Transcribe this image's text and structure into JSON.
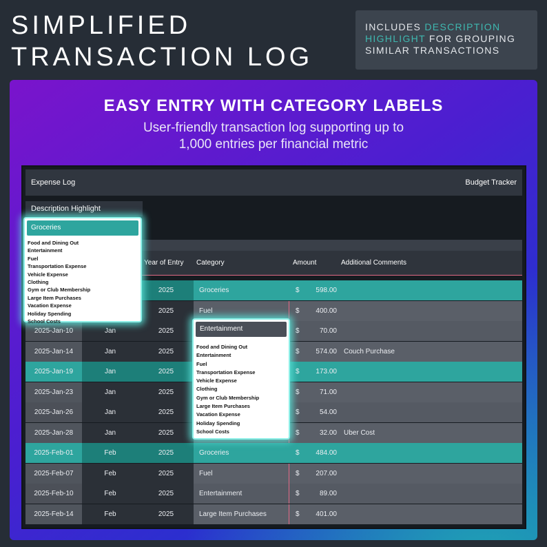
{
  "title": {
    "line1": "SIMPLIFIED",
    "line2": "TRANSACTION LOG"
  },
  "callout": {
    "prefix": "INCLUDES ",
    "highlight_1": "DESCRIPTION",
    "highlight_2": "HIGHLIGHT",
    "suffix": " FOR GROUPING SIMILAR TRANSACTIONS",
    "highlight_color": "#3fb8b0"
  },
  "panel": {
    "heading": "EASY ENTRY WITH CATEGORY LABELS",
    "subtitle_line1": "User-friendly transaction log supporting up to",
    "subtitle_line2": "1,000 entries per financial metric"
  },
  "sheet": {
    "left_title": "Expense Log",
    "right_title": "Budget Tracker",
    "description_label": "Description Highlight",
    "columns": {
      "year": "Year of Entry",
      "category": "Category",
      "amount": "Amount",
      "comments": "Additional Comments"
    },
    "currency": "$",
    "rows": [
      {
        "date": "",
        "month": "",
        "year": "2025",
        "category": "Groceries",
        "amount": "598.00",
        "comment": ""
      },
      {
        "date": "",
        "month": "",
        "year": "2025",
        "category": "Fuel",
        "amount": "400.00",
        "comment": ""
      },
      {
        "date": "2025-Jan-10",
        "month": "Jan",
        "year": "2025",
        "category": "",
        "amount": "70.00",
        "comment": ""
      },
      {
        "date": "2025-Jan-14",
        "month": "Jan",
        "year": "2025",
        "category": "",
        "amount": "574.00",
        "comment": "Couch Purchase"
      },
      {
        "date": "2025-Jan-19",
        "month": "Jan",
        "year": "2025",
        "category": "",
        "amount": "173.00",
        "comment": ""
      },
      {
        "date": "2025-Jan-23",
        "month": "Jan",
        "year": "2025",
        "category": "",
        "amount": "71.00",
        "comment": ""
      },
      {
        "date": "2025-Jan-26",
        "month": "Jan",
        "year": "2025",
        "category": "",
        "amount": "54.00",
        "comment": ""
      },
      {
        "date": "2025-Jan-28",
        "month": "Jan",
        "year": "2025",
        "category": "",
        "amount": "32.00",
        "comment": "Uber Cost"
      },
      {
        "date": "2025-Feb-01",
        "month": "Feb",
        "year": "2025",
        "category": "Groceries",
        "amount": "484.00",
        "comment": ""
      },
      {
        "date": "2025-Feb-07",
        "month": "Feb",
        "year": "2025",
        "category": "Fuel",
        "amount": "207.00",
        "comment": ""
      },
      {
        "date": "2025-Feb-10",
        "month": "Feb",
        "year": "2025",
        "category": "Entertainment",
        "amount": "89.00",
        "comment": ""
      },
      {
        "date": "2025-Feb-14",
        "month": "Feb",
        "year": "2025",
        "category": "Large Item Purchases",
        "amount": "401.00",
        "comment": ""
      }
    ]
  },
  "dropdown_description": {
    "selected": "Groceries",
    "options": [
      "Food and Dining Out",
      "Entertainment",
      "Fuel",
      "Transportation Expense",
      "Vehicle Expense",
      "Clothing",
      "Gym or Club Membership",
      "Large Item Purchases",
      "Vacation Expense",
      "Holiday Spending",
      "School Costs"
    ]
  },
  "dropdown_category": {
    "selected": "Entertainment",
    "options": [
      "Food and Dining Out",
      "Entertainment",
      "Fuel",
      "Transportation Expense",
      "Vehicle Expense",
      "Clothing",
      "Gym or Club Membership",
      "Large Item Purchases",
      "Vacation Expense",
      "Holiday Spending",
      "School Costs"
    ]
  },
  "colors": {
    "background": "#262d36",
    "teal_highlight": "#2ea59e",
    "accent_divider": "#e36a86"
  }
}
